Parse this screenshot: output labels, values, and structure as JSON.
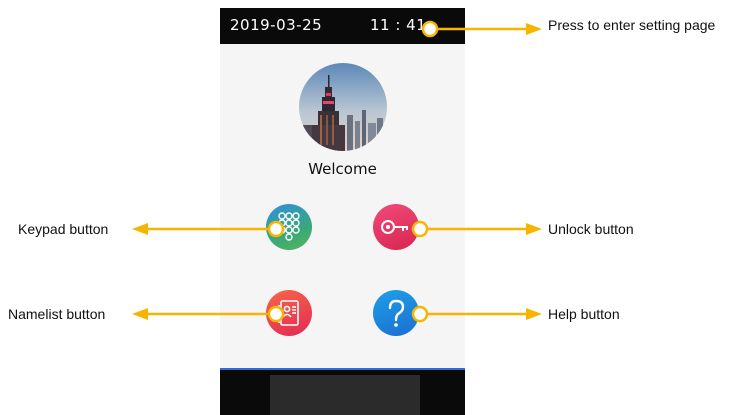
{
  "status_bar": {
    "date": "2019-03-25",
    "time": "11 : 41"
  },
  "welcome": {
    "text": "Welcome"
  },
  "buttons": {
    "keypad": {
      "icon": "keypad-icon"
    },
    "unlock": {
      "icon": "key-icon"
    },
    "namelist": {
      "icon": "contact-card-icon"
    },
    "help": {
      "icon": "question-mark-icon"
    }
  },
  "annotations": {
    "setting": "Press to enter setting page",
    "keypad": "Keypad button",
    "unlock": "Unlock button",
    "namelist": "Namelist button",
    "help": "Help button"
  },
  "colors": {
    "arrow": "#f7b500",
    "marker_fill": "#ffffff",
    "status_bar": "#0a0a0a",
    "screen_bg": "#f5f5f5",
    "bottom_bar_accent": "#2b6fd6"
  }
}
